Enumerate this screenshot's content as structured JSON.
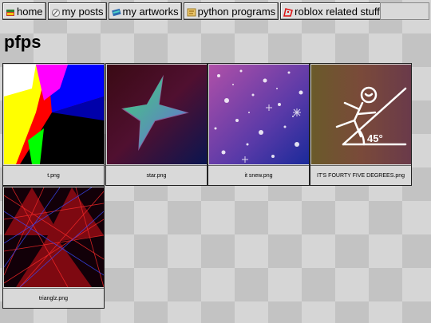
{
  "nav": {
    "items": [
      {
        "label": "home",
        "icon": "home-icon"
      },
      {
        "label": "my posts",
        "icon": "posts-icon"
      },
      {
        "label": "my artworks",
        "icon": "artworks-icon"
      },
      {
        "label": "python programs",
        "icon": "python-icon"
      },
      {
        "label": "roblox related stuff",
        "icon": "roblox-icon"
      }
    ]
  },
  "page": {
    "title": "pfps"
  },
  "gallery": [
    {
      "caption": "t.png"
    },
    {
      "caption": "star.png"
    },
    {
      "caption": "it snew.png"
    },
    {
      "caption": "IT'S FOURTY FIVE DEGREES.png"
    },
    {
      "caption": "trianglz.png"
    }
  ],
  "art": {
    "angle_label": "45°"
  }
}
